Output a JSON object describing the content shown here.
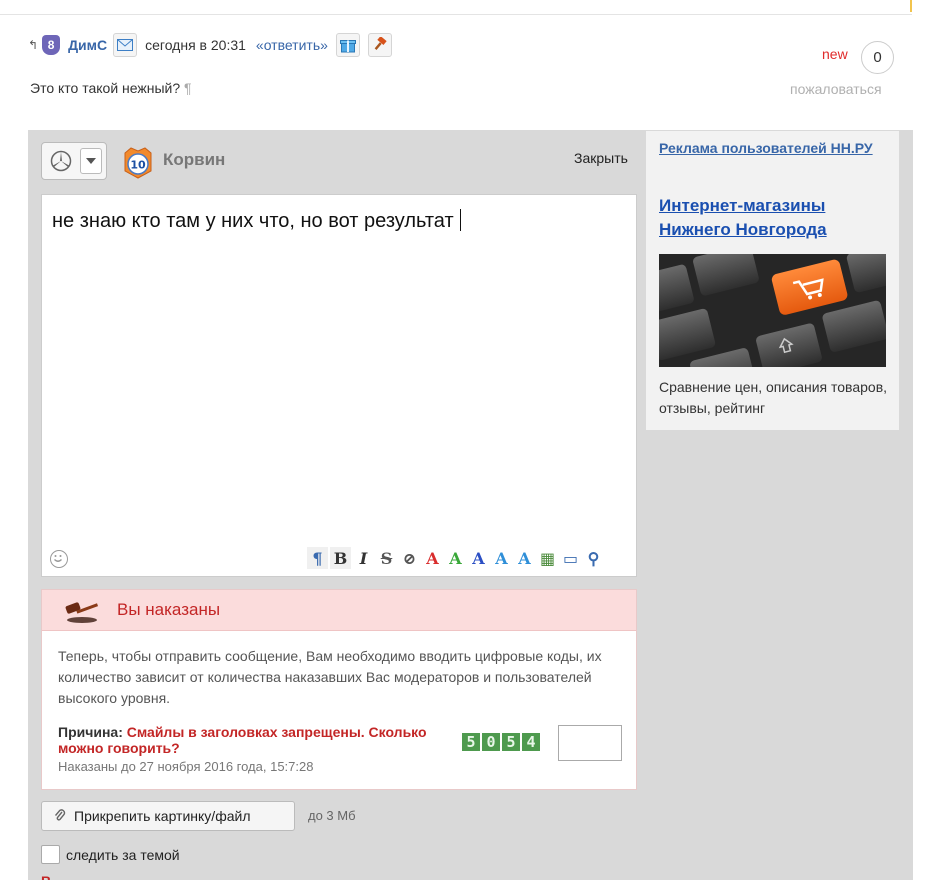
{
  "comment": {
    "reply_arrow": "↰",
    "badge": "8",
    "author": "ДимС",
    "time": "сегодня в 20:31",
    "reply_label": "«ответить»",
    "new_label": "new",
    "count": "0",
    "text": "Это кто такой нежный?",
    "pilcrow": "¶",
    "complain_label": "пожаловаться"
  },
  "editor": {
    "user_name": "Корвин",
    "user_badge": "10",
    "close_label": "Закрыть",
    "text": "не знаю кто там у них что, но вот результат",
    "toolbar": [
      "¶",
      "B",
      "I",
      "S",
      "⊘",
      "A",
      "A",
      "A",
      "A",
      "A",
      "▦",
      "▭",
      "⚲"
    ],
    "toolbar_colors": [
      "#3a6bb0",
      "#333",
      "#333",
      "#555",
      "#555",
      "#d92d2d",
      "#39a839",
      "#2b4fc4",
      "#2f8fd8",
      "#2f8fd8",
      "#4a8a3a",
      "#3a6bb0",
      "#3a6bb0"
    ]
  },
  "punish": {
    "title": "Вы наказаны",
    "text": "Теперь, чтобы отправить сообщение, Вам необходимо вводить цифровые коды, их количество зависит от количества наказавших Вас модераторов и пользователей высокого уровня.",
    "reason_label": "Причина:",
    "reason_value": "Смайлы в заголовках запрещены. Сколько можно говорить?",
    "until": "Наказаны до 27 ноября 2016 года, 15:7:28",
    "captcha": [
      "5",
      "0",
      "5",
      "4"
    ],
    "code_value": ""
  },
  "attach": {
    "label": "Прикрепить картинку/файл",
    "limit": "до 3 Мб"
  },
  "follow": {
    "label": "следить за темой",
    "checked": false
  },
  "ad": {
    "title": "Реклама пользователей НН.РУ",
    "heading": "Интернет-магазины Нижнего Новгорода",
    "text": "Сравнение цен, описания товаров, отзывы, рейтинг"
  },
  "colors": {
    "link": "#3866a8",
    "error": "#c32626",
    "panel": "#d9d9d9"
  }
}
